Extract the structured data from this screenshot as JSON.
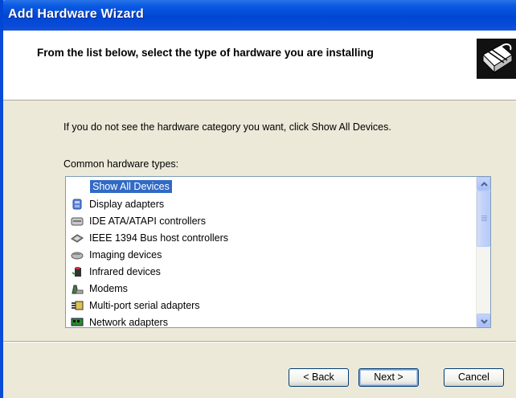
{
  "window": {
    "title": "Add Hardware Wizard"
  },
  "header": {
    "heading": "From the list below, select the type of hardware you are installing",
    "icon": "hardware-wizard-icon"
  },
  "instruction": "If you do not see the hardware category you want, click Show All Devices.",
  "list": {
    "label": "Common hardware types:",
    "selected_index": 0,
    "items": [
      {
        "label": "Show All Devices",
        "icon": "none"
      },
      {
        "label": "Display adapters",
        "icon": "display-adapter-icon"
      },
      {
        "label": "IDE ATA/ATAPI controllers",
        "icon": "ide-controller-icon"
      },
      {
        "label": "IEEE 1394 Bus host controllers",
        "icon": "ieee1394-icon"
      },
      {
        "label": "Imaging devices",
        "icon": "imaging-device-icon"
      },
      {
        "label": "Infrared devices",
        "icon": "infrared-device-icon"
      },
      {
        "label": "Modems",
        "icon": "modem-icon"
      },
      {
        "label": "Multi-port serial adapters",
        "icon": "serial-adapter-icon"
      },
      {
        "label": "Network adapters",
        "icon": "network-adapter-icon"
      }
    ]
  },
  "buttons": {
    "back": "< Back",
    "next": "Next >",
    "cancel": "Cancel"
  },
  "colors": {
    "titlebar": "#0046d5",
    "selection": "#316ac5",
    "dialog": "#ece9d8"
  }
}
